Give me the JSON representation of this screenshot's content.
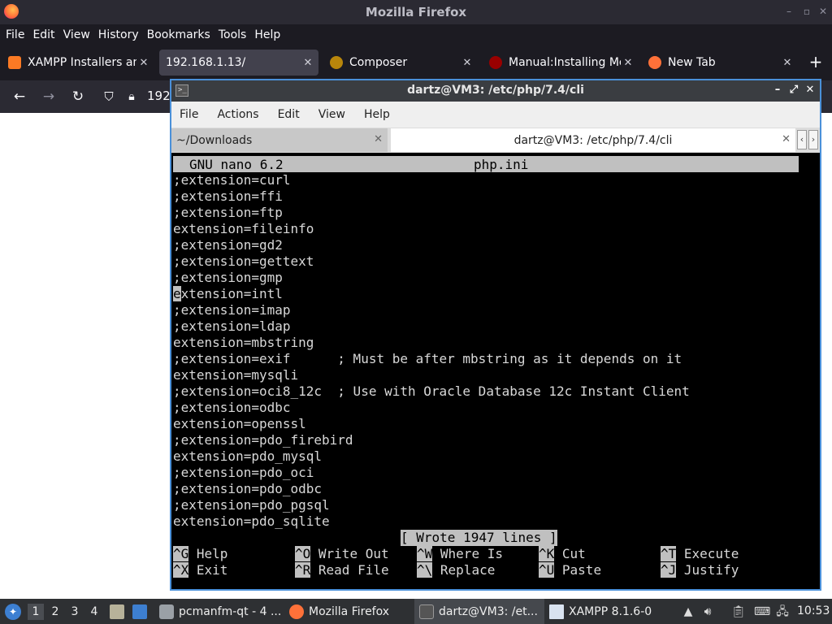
{
  "firefox": {
    "window_title": "Mozilla Firefox",
    "menu": [
      "File",
      "Edit",
      "View",
      "History",
      "Bookmarks",
      "Tools",
      "Help"
    ],
    "tabs": [
      {
        "label": "XAMPP Installers and",
        "favicon_color": "#fb7a24",
        "close": "✕"
      },
      {
        "label": "192.168.1.13/",
        "favicon_color": "",
        "close": "✕"
      },
      {
        "label": "Composer",
        "favicon_color": "#b8860b",
        "close": "✕"
      },
      {
        "label": "Manual:Installing Me",
        "favicon_color": "#990000",
        "close": "✕"
      },
      {
        "label": "New Tab",
        "favicon_color": "#ff7139",
        "close": "✕"
      }
    ],
    "new_tab": "+",
    "url_partial": "192"
  },
  "terminal": {
    "title": "dartz@VM3: /etc/php/7.4/cli",
    "menu": [
      "File",
      "Actions",
      "Edit",
      "View",
      "Help"
    ],
    "tabs": [
      {
        "label": "~/Downloads",
        "close": "✕"
      },
      {
        "label": "dartz@VM3: /etc/php/7.4/cli",
        "close": "✕"
      }
    ],
    "arrows": [
      "‹",
      "›"
    ]
  },
  "nano": {
    "version": "GNU nano 6.2",
    "filename": "php.ini",
    "lines": [
      ";extension=curl",
      ";extension=ffi",
      ";extension=ftp",
      "extension=fileinfo",
      ";extension=gd2",
      ";extension=gettext",
      ";extension=gmp",
      "xtension=intl",
      ";extension=imap",
      ";extension=ldap",
      "extension=mbstring",
      ";extension=exif      ; Must be after mbstring as it depends on it",
      "extension=mysqli",
      ";extension=oci8_12c  ; Use with Oracle Database 12c Instant Client",
      ";extension=odbc",
      "extension=openssl",
      ";extension=pdo_firebird",
      "extension=pdo_mysql",
      ";extension=pdo_oci",
      ";extension=pdo_odbc",
      ";extension=pdo_pgsql",
      "extension=pdo_sqlite"
    ],
    "cursor_char": "e",
    "status": "[ Wrote 1947 lines ]",
    "shortcuts": [
      {
        "key": "^G",
        "label": "Help"
      },
      {
        "key": "^O",
        "label": "Write Out"
      },
      {
        "key": "^W",
        "label": "Where Is"
      },
      {
        "key": "^K",
        "label": "Cut"
      },
      {
        "key": "^T",
        "label": "Execute"
      },
      {
        "key": "^X",
        "label": "Exit"
      },
      {
        "key": "^R",
        "label": "Read File"
      },
      {
        "key": "^\\",
        "label": "Replace"
      },
      {
        "key": "^U",
        "label": "Paste"
      },
      {
        "key": "^J",
        "label": "Justify"
      }
    ]
  },
  "taskbar": {
    "desktops": [
      "1",
      "2",
      "3",
      "4"
    ],
    "windows": [
      {
        "label": "pcmanfm-qt - 4 ...",
        "icon_color": "#9aa0a6"
      },
      {
        "label": "Mozilla Firefox",
        "icon_color": "#ff7139"
      },
      {
        "label": "dartz@VM3: /et...",
        "icon_color": "#555555"
      },
      {
        "label": "XAMPP 8.1.6-0",
        "icon_color": "#d9e3f0"
      }
    ],
    "clock": "10:53"
  }
}
